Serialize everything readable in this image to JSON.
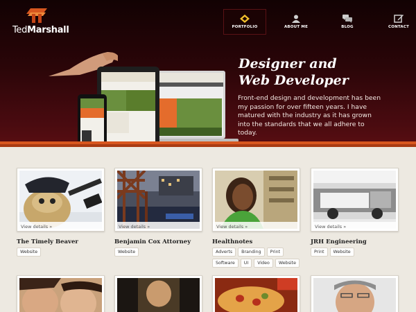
{
  "brand": {
    "first": "Ted",
    "last": "Marshall"
  },
  "nav": [
    {
      "label": "PORTFOLIO",
      "icon": "code-icon",
      "active": true
    },
    {
      "label": "ABOUT ME",
      "icon": "person-icon",
      "active": false
    },
    {
      "label": "BLOG",
      "icon": "chat-icon",
      "active": false
    },
    {
      "label": "CONTACT",
      "icon": "edit-icon",
      "active": false
    }
  ],
  "hero": {
    "headline_line1": "Designer and",
    "headline_line2": "Web Developer",
    "copy": "Front-end design and development has been my passion for over fifteen years. I have matured with the industry as it has grown into the standards that we all adhere to today."
  },
  "portfolio": [
    {
      "title": "The Timely Beaver",
      "view": "View details »",
      "tags": [
        "Website"
      ]
    },
    {
      "title": "Benjamin Cox Attorney",
      "view": "View details »",
      "tags": [
        "Website"
      ]
    },
    {
      "title": "Healthnotes",
      "view": "View details »",
      "tags": [
        "Adverts",
        "Branding",
        "Print",
        "Software",
        "UI",
        "Video",
        "Website"
      ]
    },
    {
      "title": "JRH Engineering",
      "view": "View details »",
      "tags": [
        "Print",
        "Website"
      ]
    }
  ],
  "colors": {
    "accent": "#d8571f",
    "hero_dark": "#2a0508"
  }
}
